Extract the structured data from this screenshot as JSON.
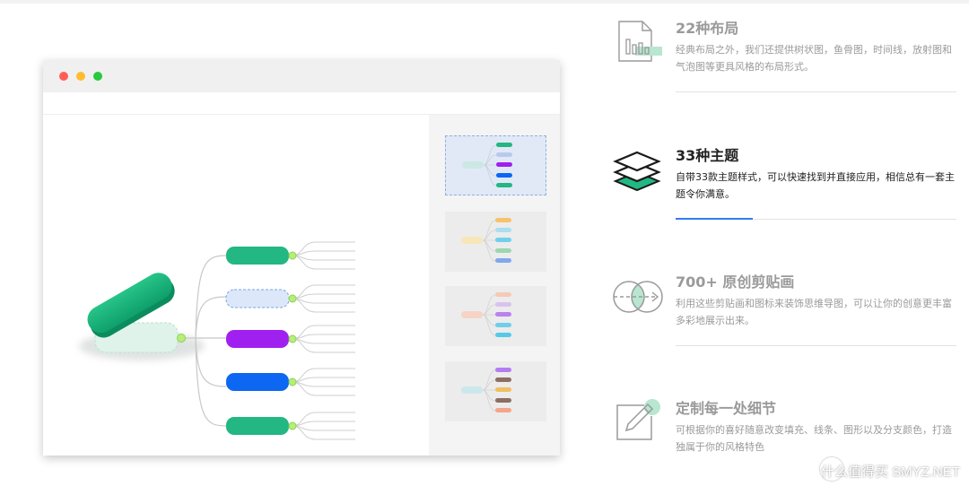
{
  "colors": {
    "accent_blue": "#2f7ef1",
    "green": "#22b783",
    "purple": "#a020f0",
    "blue": "#0d67f2",
    "dot_red": "#ff5f56",
    "dot_yellow": "#ffbd2e",
    "dot_green": "#27c93f"
  },
  "window": {
    "controls": [
      "close",
      "minimize",
      "maximize"
    ],
    "mindmap": {
      "root_shape": "green-pill",
      "branches": [
        {
          "color": "#22b783",
          "style": "solid"
        },
        {
          "color": "#dce8fa",
          "style": "dashed"
        },
        {
          "color": "#a020f0",
          "style": "solid"
        },
        {
          "color": "#0d67f2",
          "style": "solid"
        },
        {
          "color": "#22b783",
          "style": "solid"
        }
      ]
    },
    "themes_panel": {
      "selected_index": 0,
      "thumbnails": [
        {
          "bg": "#e1e9f6",
          "root": "#cce8e4",
          "bars": [
            "#22b783",
            "#b9c9ee",
            "#a020f0",
            "#0d67f2",
            "#22b783"
          ]
        },
        {
          "bg": "#ececec",
          "root": "#f7e6b8",
          "bars": [
            "#f6c36b",
            "#a8e0ef",
            "#6fd0ea",
            "#9ad8b0",
            "#7fa8ee"
          ]
        },
        {
          "bg": "#ececec",
          "root": "#f6d3c6",
          "bars": [
            "#f6c9b8",
            "#d9c3ee",
            "#b982ef",
            "#6fcfe8",
            "#57c9e8"
          ]
        },
        {
          "bg": "#ececec",
          "root": "#cbe7ec",
          "bars": [
            "#b57cf1",
            "#8d6e63",
            "#f0c060",
            "#8d6e63",
            "#f4a58a"
          ]
        }
      ]
    }
  },
  "features": [
    {
      "icon": "layout-chart-icon",
      "title": "22种布局",
      "desc": "经典布局之外，我们还提供树状图，鱼骨图，时间线，放射图和气泡图等更具风格的布局形式。",
      "active": false
    },
    {
      "icon": "layers-theme-icon",
      "title": "33种主题",
      "desc": "自带33款主题样式，可以快速找到并直接应用，相信总有一套主题令你满意。",
      "active": true,
      "progress": 0.27
    },
    {
      "icon": "venn-clipart-icon",
      "title": "700+ 原创剪贴画",
      "desc": "利用这些剪贴画和图标来装饰思维导图，可以让你的创意更丰富多彩地展示出来。",
      "active": false
    },
    {
      "icon": "edit-pencil-icon",
      "title": "定制每一处细节",
      "desc": "可根据你的喜好随意改变填充、线条、图形以及分支颜色，打造独属于你的风格特色",
      "active": false
    }
  ],
  "watermark": "什么值得买 SMYZ.NET"
}
